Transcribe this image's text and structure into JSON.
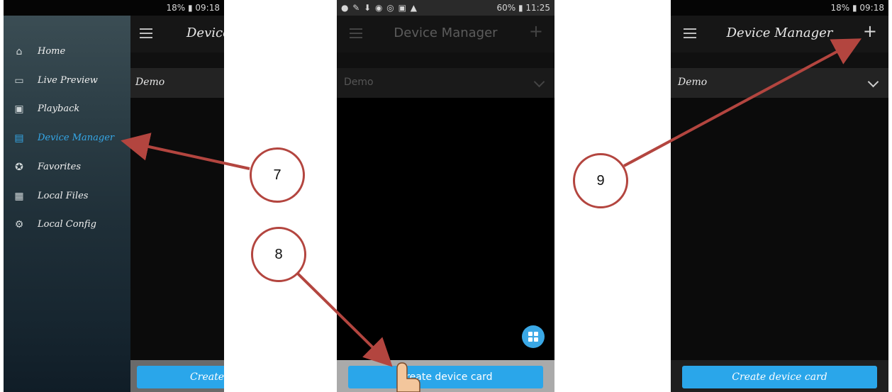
{
  "colors": {
    "accent": "#2aa6ea",
    "arrow": "#b3453f",
    "drawer_active": "#35a8e8"
  },
  "panel1": {
    "status_right": "09:18",
    "status_battery": "18%",
    "title": "Device",
    "group_name": "Demo",
    "bottom_button": "Create",
    "drawer": [
      {
        "label": "Home",
        "icon": "home-icon",
        "active": false
      },
      {
        "label": "Live Preview",
        "icon": "live-preview-icon",
        "active": false
      },
      {
        "label": "Playback",
        "icon": "playback-icon",
        "active": false
      },
      {
        "label": "Device Manager",
        "icon": "device-manager-icon",
        "active": true
      },
      {
        "label": "Favorites",
        "icon": "favorites-icon",
        "active": false
      },
      {
        "label": "Local Files",
        "icon": "local-files-icon",
        "active": false
      },
      {
        "label": "Local Config",
        "icon": "local-config-icon",
        "active": false
      }
    ]
  },
  "panel2": {
    "status_right": "11:25",
    "status_battery": "60%",
    "title": "Device Manager",
    "group_name": "Demo",
    "bottom_button": "Create device card"
  },
  "panel3": {
    "status_right": "09:18",
    "status_battery": "18%",
    "title": "Device Manager",
    "group_name": "Demo",
    "bottom_button": "Create device card"
  },
  "callouts": {
    "c7": "7",
    "c8": "8",
    "c9": "9"
  }
}
